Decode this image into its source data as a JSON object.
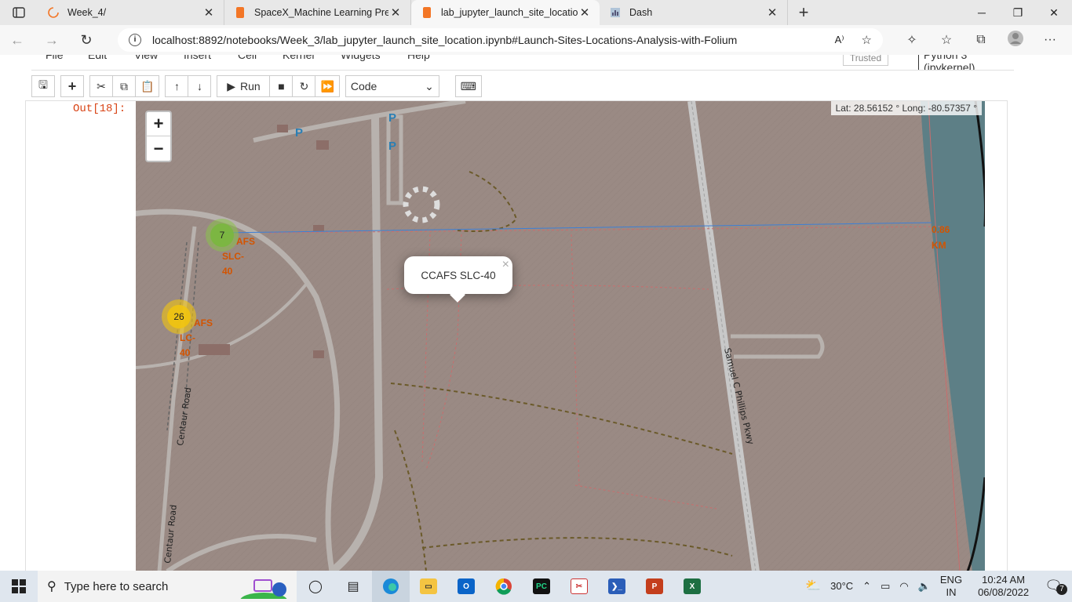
{
  "browser": {
    "tabs": [
      {
        "title": "Week_4/",
        "active": false
      },
      {
        "title": "SpaceX_Machine Learning Predic",
        "active": false
      },
      {
        "title": "lab_jupyter_launch_site_location",
        "active": true
      },
      {
        "title": "Dash",
        "active": false
      }
    ],
    "url": "localhost:8892/notebooks/Week_3/lab_jupyter_launch_site_location.ipynb#Launch-Sites-Locations-Analysis-with-Folium"
  },
  "notebook": {
    "menu": [
      "File",
      "Edit",
      "View",
      "Insert",
      "Cell",
      "Kernel",
      "Widgets",
      "Help"
    ],
    "trusted": "Trusted",
    "kernel": "Python 3 (ipykernel)",
    "toolbar": {
      "run_label": "Run",
      "cell_type": "Code"
    },
    "out_prompt": "Out[18]:"
  },
  "map": {
    "mouse_position": "Lat: 28.56152 ° Long: -80.57357 °",
    "zoom_in": "+",
    "zoom_out": "−",
    "clusters": [
      {
        "count": "7",
        "color": "#8bc34a"
      },
      {
        "count": "26",
        "color": "#f1c40f"
      }
    ],
    "site_labels": [
      {
        "lines": [
          "AFS",
          "SLC-",
          "40"
        ]
      },
      {
        "lines": [
          "AFS",
          "LC-",
          "40"
        ]
      }
    ],
    "popup": "CCAFS SLC-40",
    "distance_label": [
      "0.86",
      "KM"
    ],
    "parking": [
      "P",
      "P",
      "P"
    ],
    "road_labels": [
      "Centaur Road",
      "Centaur Road",
      "Samuel C Phillips Pkwy"
    ],
    "colors": {
      "land": "#9a8a84",
      "water": "#5d7f86",
      "road": "#b8b2ae",
      "line": "#3d7fd6",
      "label": "#d35400"
    }
  },
  "taskbar": {
    "search_placeholder": "Type here to search",
    "weather": "30°C",
    "lang_top": "ENG",
    "lang_bottom": "IN",
    "time": "10:24 AM",
    "date": "06/08/2022",
    "notifications": "7"
  }
}
